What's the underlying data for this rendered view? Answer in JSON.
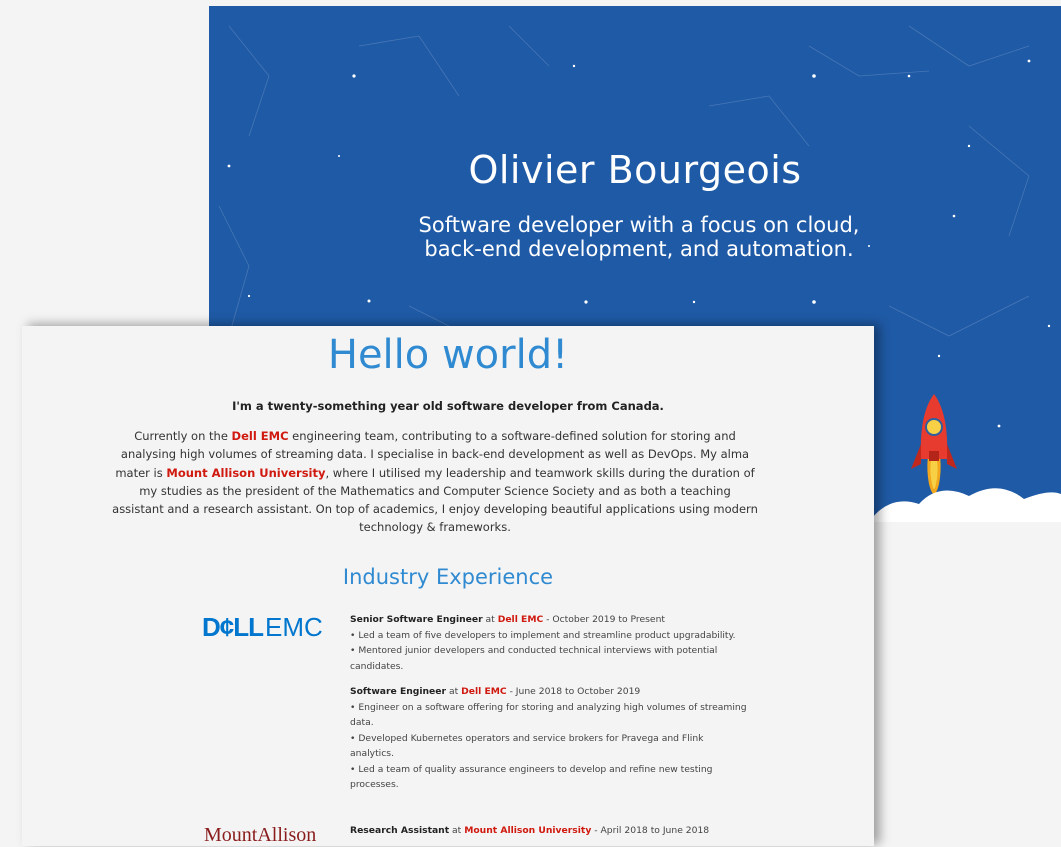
{
  "hero": {
    "name": "Olivier Bourgeois",
    "tagline_line1": "Software developer with a focus on cloud,",
    "tagline_line2": "back-end development, and automation."
  },
  "about": {
    "heading": "Hello world!",
    "intro": "I'm a twenty-something year old software developer from Canada.",
    "bio_1": "Currently on the ",
    "bio_dell": "Dell EMC",
    "bio_2": " engineering team, contributing to a software-defined solution for storing and analysing high volumes of streaming data. I specialise in back-end development as well as DevOps. My alma mater is ",
    "bio_mta": "Mount Allison University",
    "bio_3": ", where I utilised my leadership and teamwork skills during the duration of my studies as the president of the Mathematics and Computer Science Society and as both a teaching assistant and a research assistant. On top of academics, I enjoy developing beautiful applications using modern technology & frameworks."
  },
  "experience": {
    "heading": "Industry Experience",
    "dell_logo_bold": "D¢LL",
    "dell_logo_light": "EMC",
    "mta_logo": "MountAllison",
    "jobs": [
      {
        "role": "Senior Software Engineer",
        "at": " at ",
        "company": "Dell EMC",
        "dates": " - October 2019 to Present",
        "bullets": [
          "• Led a team of five developers to implement and streamline product upgradability.",
          "• Mentored junior developers and conducted technical interviews with potential candidates."
        ]
      },
      {
        "role": "Software Engineer",
        "at": " at ",
        "company": "Dell EMC",
        "dates": " - June 2018 to October 2019",
        "bullets": [
          "• Engineer on a software offering for storing and analyzing high volumes of streaming data.",
          "• Developed Kubernetes operators and service brokers for Pravega and Flink analytics.",
          "• Led a team of quality assurance engineers to develop and refine new testing processes."
        ]
      },
      {
        "role": "Research Assistant",
        "at": " at ",
        "company": "Mount Allison University",
        "dates": " - April 2018 to June 2018",
        "bullets": []
      }
    ]
  },
  "colors": {
    "hero_bg": "#1f5aa6",
    "accent_blue": "#2f8ad1",
    "highlight_red": "#d0190f"
  }
}
